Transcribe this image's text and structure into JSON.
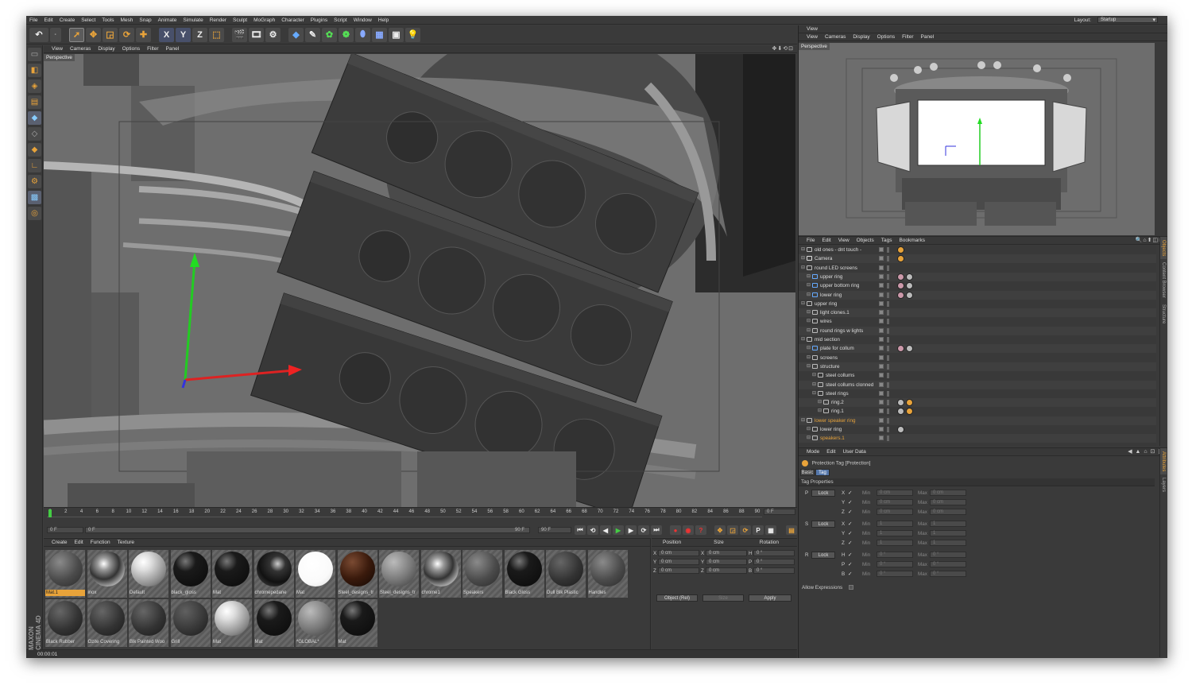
{
  "menu": [
    "File",
    "Edit",
    "Create",
    "Select",
    "Tools",
    "Mesh",
    "Snap",
    "Animate",
    "Simulate",
    "Render",
    "Sculpt",
    "MoGraph",
    "Character",
    "Plugins",
    "Script",
    "Window",
    "Help"
  ],
  "layout": {
    "label": "Layout:",
    "value": "Startup"
  },
  "toolbar": {
    "x": "X",
    "y": "Y",
    "z": "Z"
  },
  "viewport": {
    "menu": [
      "View",
      "Cameras",
      "Display",
      "Options",
      "Filter",
      "Panel"
    ],
    "label": "Perspective",
    "controls": "✥⬇⟲⊡"
  },
  "right_view": {
    "title": "View",
    "menu": [
      "View",
      "Cameras",
      "Display",
      "Options",
      "Filter",
      "Panel"
    ],
    "label": "Perspective"
  },
  "timeline": {
    "ticks": [
      "0",
      "2",
      "4",
      "6",
      "8",
      "10",
      "12",
      "14",
      "16",
      "18",
      "20",
      "22",
      "24",
      "26",
      "28",
      "30",
      "32",
      "34",
      "36",
      "38",
      "40",
      "42",
      "44",
      "46",
      "48",
      "50",
      "52",
      "54",
      "56",
      "58",
      "60",
      "62",
      "64",
      "66",
      "68",
      "70",
      "72",
      "74",
      "76",
      "78",
      "80",
      "82",
      "84",
      "86",
      "88",
      "90"
    ],
    "current": "0 F",
    "start": "0 F",
    "range_start": "0 F",
    "range_end": "90 F",
    "end": "90 F",
    "frame_display": "0 F"
  },
  "material_manager": {
    "menu": [
      "Create",
      "Edit",
      "Function",
      "Texture"
    ],
    "materials": [
      {
        "name": "Mat.1",
        "style": "grey",
        "selected": true
      },
      {
        "name": "inox",
        "style": "chrome"
      },
      {
        "name": "Default",
        "style": "glossy-light"
      },
      {
        "name": "black_gloss",
        "style": "black"
      },
      {
        "name": "Mat",
        "style": "black"
      },
      {
        "name": "chromepedane",
        "style": "chrome-dark"
      },
      {
        "name": "Mat",
        "style": "white"
      },
      {
        "name": "Steel_designs_tr",
        "style": "brown"
      },
      {
        "name": "Steel_designs_tr",
        "style": "grey-light"
      },
      {
        "name": "chrome1",
        "style": "chrome"
      },
      {
        "name": "Speakers",
        "style": "grey"
      },
      {
        "name": "Black Gloss",
        "style": "black"
      },
      {
        "name": "Dull Blk Plastic",
        "style": "grey-dark"
      },
      {
        "name": "Handles",
        "style": "grey"
      },
      {
        "name": "Black Rubber",
        "style": "grey-dark"
      },
      {
        "name": "Ozite Covering",
        "style": "grey-dark"
      },
      {
        "name": "Blk Painted Woo",
        "style": "grey-dark"
      },
      {
        "name": "Grill",
        "style": "grill"
      },
      {
        "name": "Mat",
        "style": "glossy-light"
      },
      {
        "name": "Mat",
        "style": "black"
      },
      {
        "name": "*GLOBAL*",
        "style": "grey-light"
      },
      {
        "name": "Mat",
        "style": "black"
      }
    ]
  },
  "coordinates": {
    "headers": [
      "Position",
      "Size",
      "Rotation"
    ],
    "rows": [
      {
        "axis": "X",
        "pos": "0 cm",
        "size_axis": "X",
        "size": "0 cm",
        "rot_axis": "H",
        "rot": "0 °"
      },
      {
        "axis": "Y",
        "pos": "0 cm",
        "size_axis": "Y",
        "size": "0 cm",
        "rot_axis": "P",
        "rot": "0 °"
      },
      {
        "axis": "Z",
        "pos": "0 cm",
        "size_axis": "Z",
        "size": "0 cm",
        "rot_axis": "B",
        "rot": "0 °"
      }
    ],
    "mode": "Object (Rel)",
    "size_mode": "Size",
    "apply": "Apply"
  },
  "status": "00:00:01",
  "logo": "MAXON CINEMA 4D",
  "objects": {
    "menu": [
      "File",
      "Edit",
      "View",
      "Objects",
      "Tags",
      "Bookmarks"
    ],
    "rows": [
      {
        "name": "old ones - dnt touch -",
        "indent": 0,
        "icon": "null",
        "tags": [
          "protect"
        ]
      },
      {
        "name": "Camera",
        "indent": 0,
        "icon": "camera",
        "tags": [
          "protect"
        ]
      },
      {
        "name": "round LED screens",
        "indent": 0,
        "icon": "null",
        "tags": []
      },
      {
        "name": "upper ring",
        "indent": 1,
        "icon": "obj",
        "tags": [
          "phong",
          "mat"
        ]
      },
      {
        "name": "upper bottom ring",
        "indent": 1,
        "icon": "obj",
        "tags": [
          "phong",
          "mat"
        ]
      },
      {
        "name": "lower ring",
        "indent": 1,
        "icon": "obj",
        "tags": [
          "phong",
          "mat"
        ]
      },
      {
        "name": "upper ring",
        "indent": 0,
        "icon": "null",
        "tags": []
      },
      {
        "name": "light clones.1",
        "indent": 1,
        "icon": "null",
        "tags": []
      },
      {
        "name": "wires",
        "indent": 1,
        "icon": "null",
        "tags": []
      },
      {
        "name": "round rings w lights",
        "indent": 1,
        "icon": "null",
        "tags": []
      },
      {
        "name": "mid section",
        "indent": 0,
        "icon": "null",
        "tags": []
      },
      {
        "name": "plate for collum",
        "indent": 1,
        "icon": "obj",
        "tags": [
          "phong",
          "mat"
        ]
      },
      {
        "name": "screens",
        "indent": 1,
        "icon": "null",
        "tags": []
      },
      {
        "name": "structure",
        "indent": 1,
        "icon": "null",
        "tags": []
      },
      {
        "name": "steel collums",
        "indent": 2,
        "icon": "null",
        "tags": []
      },
      {
        "name": "steel collums clonned",
        "indent": 2,
        "icon": "null",
        "tags": []
      },
      {
        "name": "steel rings",
        "indent": 2,
        "icon": "null",
        "tags": []
      },
      {
        "name": "ring.2",
        "indent": 3,
        "icon": "null",
        "tags": [
          "mat",
          "protect"
        ]
      },
      {
        "name": "ring.1",
        "indent": 3,
        "icon": "null",
        "tags": [
          "mat",
          "protect"
        ]
      },
      {
        "name": "lower speaker ring",
        "indent": 0,
        "icon": "null",
        "tags": [],
        "hl": true
      },
      {
        "name": "lower ring",
        "indent": 1,
        "icon": "null",
        "tags": [
          "mat"
        ]
      },
      {
        "name": "speakers.1",
        "indent": 1,
        "icon": "null",
        "tags": [],
        "hl": true
      }
    ],
    "side_tabs": [
      "Objects",
      "Content Browser",
      "Structure"
    ]
  },
  "attributes": {
    "menu": [
      "Mode",
      "Edit",
      "User Data"
    ],
    "title": "Protection Tag [Protection]",
    "tabs": [
      "Basic",
      "Tag"
    ],
    "section": "Tag Properties",
    "groups": [
      {
        "key": "P",
        "lock": "Lock",
        "axes": [
          "X",
          "Y",
          "Z"
        ],
        "min": "0 cm",
        "max": "0 cm"
      },
      {
        "key": "S",
        "lock": "Lock",
        "axes": [
          "X",
          "Y",
          "Z"
        ],
        "min": "1",
        "max": "1"
      },
      {
        "key": "R",
        "lock": "Lock",
        "axes": [
          "H",
          "P",
          "B"
        ],
        "min": "0 °",
        "max": "0 °"
      }
    ],
    "min_label": "Min",
    "max_label": "Max",
    "allow": "Allow Expressions",
    "side_tabs": [
      "Attributes",
      "Layers"
    ]
  }
}
